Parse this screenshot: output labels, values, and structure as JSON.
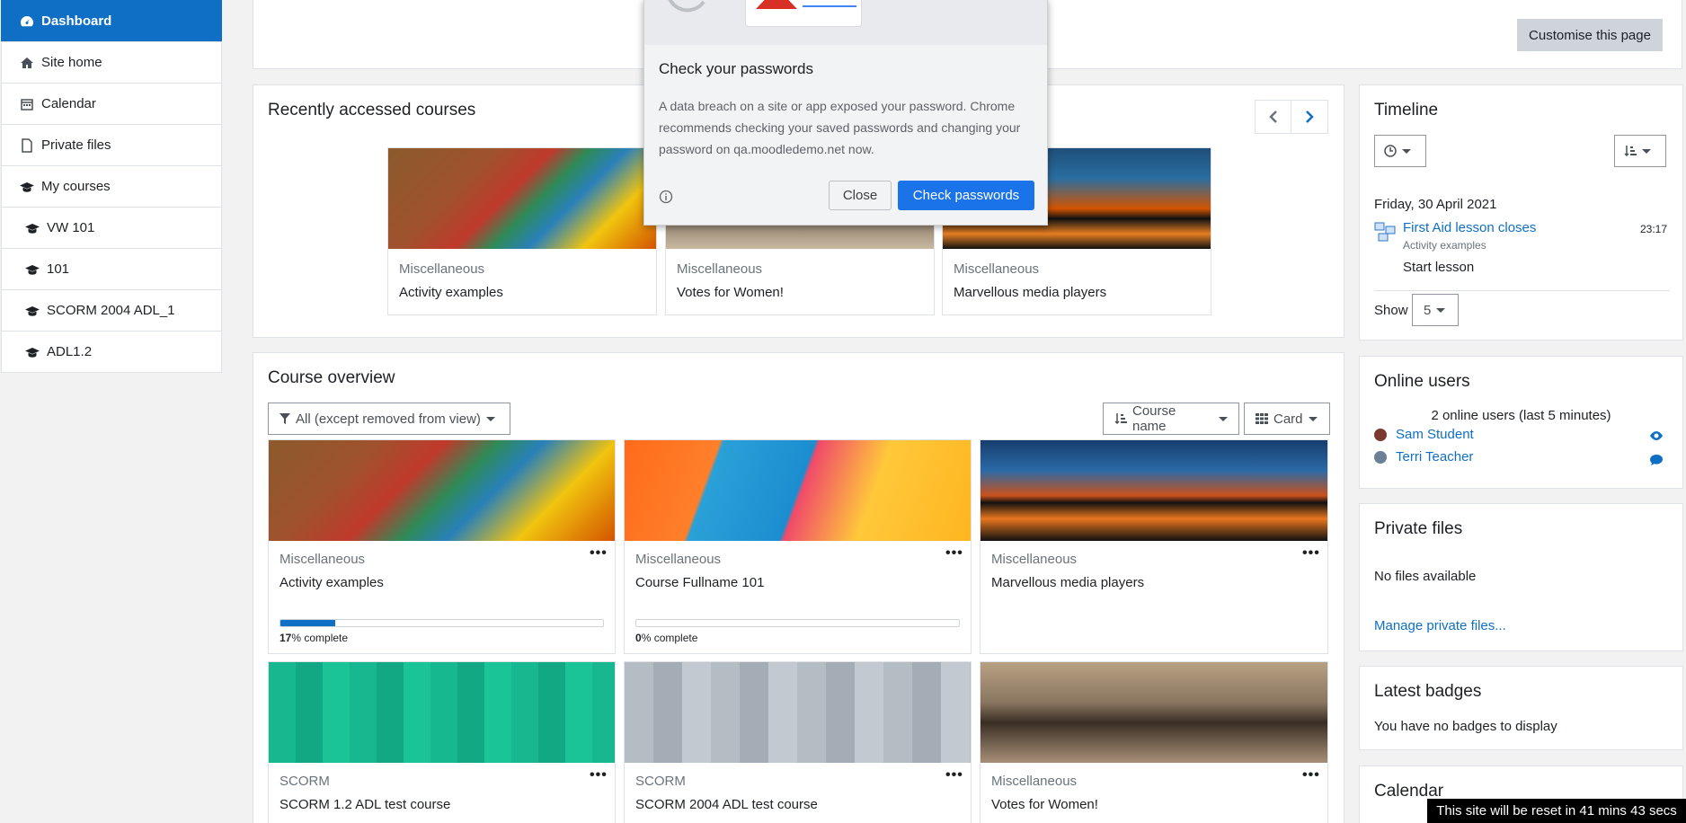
{
  "nav": {
    "items": [
      {
        "label": "Dashboard",
        "icon": "dashboard-icon"
      },
      {
        "label": "Site home",
        "icon": "home-icon"
      },
      {
        "label": "Calendar",
        "icon": "calendar-icon"
      },
      {
        "label": "Private files",
        "icon": "file-icon"
      },
      {
        "label": "My courses",
        "icon": "graduation-cap-icon"
      },
      {
        "label": "VW 101",
        "icon": "graduation-cap-icon"
      },
      {
        "label": "101",
        "icon": "graduation-cap-icon"
      },
      {
        "label": "SCORM 2004 ADL_1",
        "icon": "graduation-cap-icon"
      },
      {
        "label": "ADL1.2",
        "icon": "graduation-cap-icon"
      }
    ]
  },
  "header": {
    "customise_label": "Customise this page"
  },
  "recent": {
    "title": "Recently accessed courses",
    "courses": [
      {
        "category": "Miscellaneous",
        "name": "Activity examples"
      },
      {
        "category": "Miscellaneous",
        "name": "Votes for Women!"
      },
      {
        "category": "Miscellaneous",
        "name": "Marvellous media players"
      }
    ]
  },
  "overview": {
    "title": "Course overview",
    "filter_label": "All (except removed from view)",
    "sort_label": "Course name",
    "view_label": "Card",
    "courses": [
      {
        "category": "Miscellaneous",
        "name": "Activity examples",
        "progress": 17,
        "progress_pct": "17",
        "progress_suffix": "% complete"
      },
      {
        "category": "Miscellaneous",
        "name": "Course Fullname 101",
        "progress": 0,
        "progress_pct": "0",
        "progress_suffix": "% complete"
      },
      {
        "category": "Miscellaneous",
        "name": "Marvellous media players"
      },
      {
        "category": "SCORM",
        "name": "SCORM 1.2 ADL test course"
      },
      {
        "category": "SCORM",
        "name": "SCORM 2004 ADL test course"
      },
      {
        "category": "Miscellaneous",
        "name": "Votes for Women!"
      }
    ]
  },
  "timeline": {
    "title": "Timeline",
    "date": "Friday, 30 April 2021",
    "event_name": "First Aid lesson closes",
    "event_course": "Activity examples",
    "event_time": "23:17",
    "event_action": "Start lesson",
    "show_label": "Show",
    "show_value": "5"
  },
  "online": {
    "title": "Online users",
    "summary": "2 online users (last 5 minutes)",
    "users": [
      "Sam Student",
      "Terri Teacher"
    ]
  },
  "private_files": {
    "title": "Private files",
    "empty": "No files available",
    "manage_link": "Manage private files..."
  },
  "badges": {
    "title": "Latest badges",
    "empty": "You have no badges to display"
  },
  "calendar": {
    "title": "Calendar"
  },
  "reset_notice": "This site will be reset in 41 mins 43 secs",
  "popup": {
    "title": "Check your passwords",
    "body": "A data breach on a site or app exposed your password. Chrome recommends checking your saved passwords and changing your password on qa.moodledemo.net now.",
    "close_label": "Close",
    "check_label": "Check passwords"
  },
  "colors": {
    "accent": "#0f6fc5",
    "chrome_blue": "#1a73e8",
    "reset_bg": "#000000"
  }
}
